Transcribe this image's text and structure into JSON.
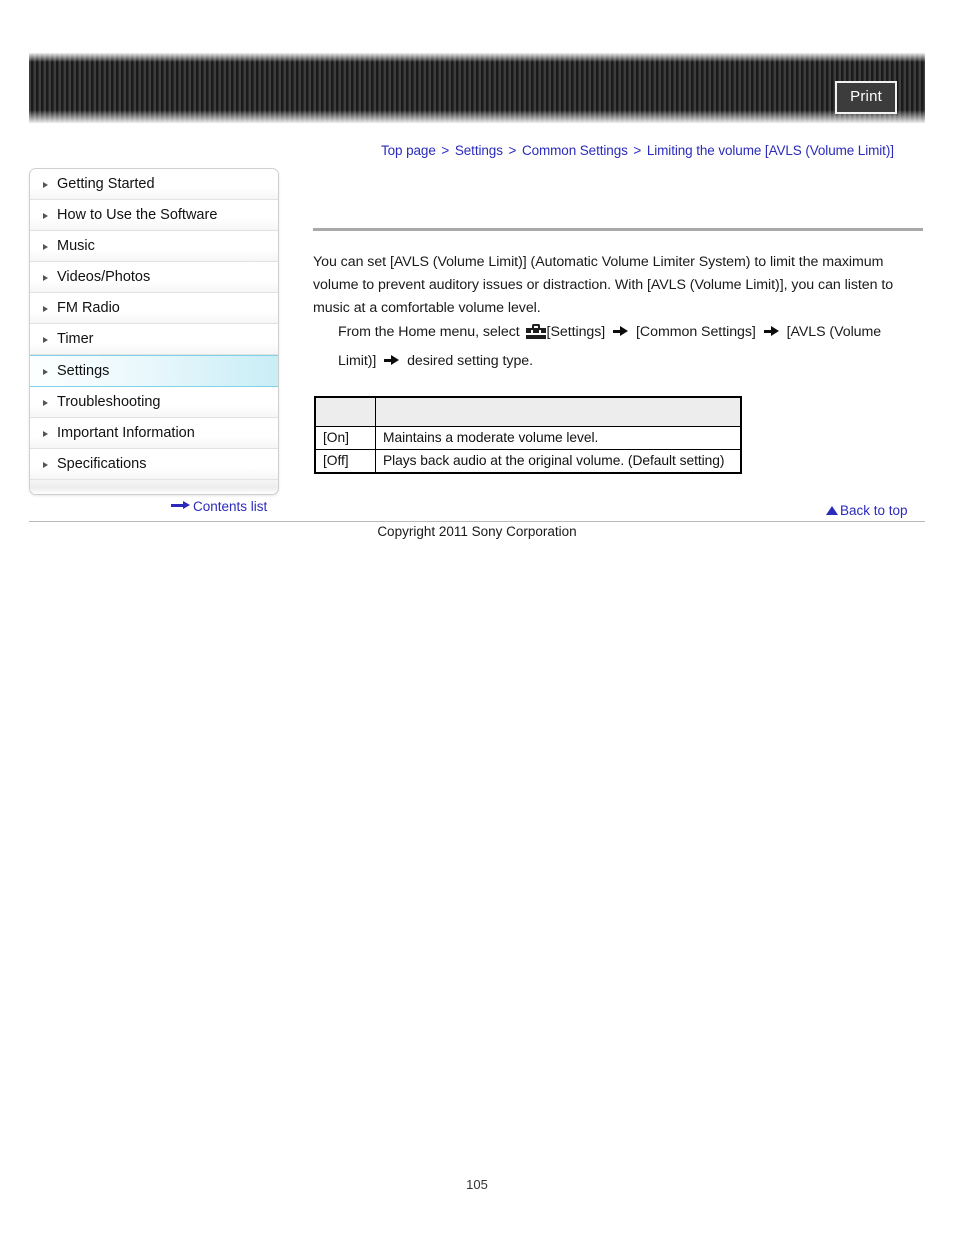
{
  "header": {
    "print_label": "Print"
  },
  "breadcrumb": {
    "items": [
      "Top page",
      "Settings",
      "Common Settings",
      "Limiting the volume [AVLS (Volume Limit)]"
    ],
    "separator": ">"
  },
  "sidebar": {
    "items": [
      {
        "label": "Getting Started",
        "active": false
      },
      {
        "label": "How to Use the Software",
        "active": false
      },
      {
        "label": "Music",
        "active": false
      },
      {
        "label": "Videos/Photos",
        "active": false
      },
      {
        "label": "FM Radio",
        "active": false
      },
      {
        "label": "Timer",
        "active": false
      },
      {
        "label": "Settings",
        "active": true
      },
      {
        "label": "Troubleshooting",
        "active": false
      },
      {
        "label": "Important Information",
        "active": false
      },
      {
        "label": "Specifications",
        "active": false
      }
    ]
  },
  "main": {
    "paragraph": "You can set [AVLS (Volume Limit)] (Automatic Volume Limiter System) to limit the maximum volume to prevent auditory issues or distraction. With [AVLS (Volume Limit)], you can listen to music at a comfortable volume level.",
    "instruction": {
      "lead": "From the Home menu, select",
      "step1": "[Settings]",
      "step2": "[Common Settings]",
      "step3": "[AVLS (Volume Limit)]",
      "step4": "desired setting type.",
      "settings_icon": "toolbox-icon",
      "arrow_icon": "arrow-right-icon"
    },
    "table": {
      "header": [
        "",
        ""
      ],
      "rows": [
        [
          "[On]",
          "Maintains a moderate volume level."
        ],
        [
          "[Off]",
          "Plays back audio at the original volume. (Default setting)"
        ]
      ]
    }
  },
  "footer": {
    "contents_label": "Contents list",
    "contents_icon": "arrow-right-icon",
    "back_to_top_label": "Back to top",
    "back_to_top_icon": "triangle-up-icon",
    "copyright": "Copyright 2011 Sony Corporation",
    "page_number": "105"
  },
  "colors": {
    "link": "#2b2bbb",
    "active_sidebar": "#c9edf6",
    "active_sidebar_border": "#7fd3e6",
    "banner_dark": "#1a1a1a",
    "banner_stripe": "#3d3d3d",
    "table_header": "#ededed",
    "rule": "#a9a9a9"
  }
}
